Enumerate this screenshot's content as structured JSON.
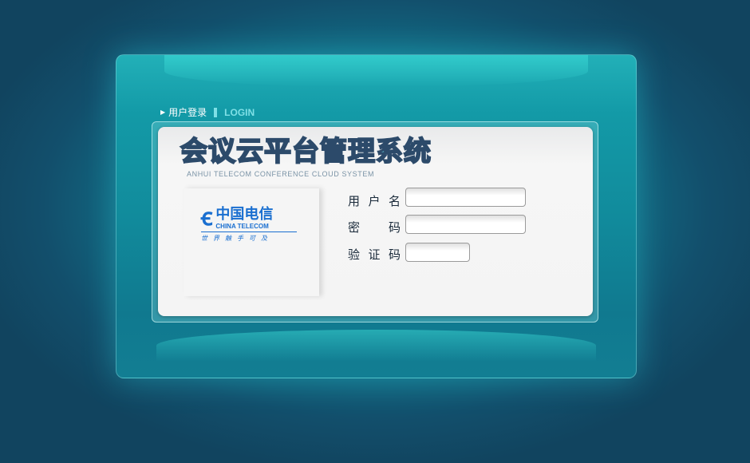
{
  "header": {
    "label_cn": "用户登录",
    "label_en": "LOGIN"
  },
  "app": {
    "title": "会议云平台管理系统",
    "subtitle": "ANHUI TELECOM CONFERENCE CLOUD SYSTEM"
  },
  "logo": {
    "name_cn": "中国电信",
    "name_en": "CHINA TELECOM",
    "slogan": "世界触手可及"
  },
  "form": {
    "username_label": [
      "用",
      "户",
      "名"
    ],
    "password_label": [
      "密",
      "码"
    ],
    "captcha_label": [
      "验",
      "证",
      "码"
    ],
    "username_value": "",
    "password_value": "",
    "captcha_value": ""
  }
}
